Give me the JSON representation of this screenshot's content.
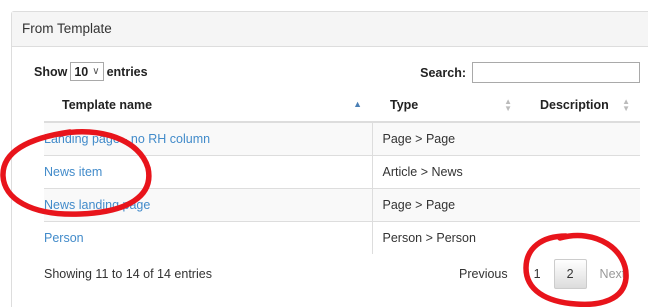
{
  "panel": {
    "title": "From Template"
  },
  "controls": {
    "show_label": "Show",
    "page_length": "10",
    "entries_label": "entries",
    "search_label": "Search:",
    "search_value": ""
  },
  "table": {
    "headers": [
      "Template name",
      "Type",
      "Description"
    ],
    "rows": [
      {
        "name": "Landing page - no RH column",
        "type": "Page > Page",
        "description": ""
      },
      {
        "name": "News item",
        "type": "Article > News",
        "description": ""
      },
      {
        "name": "News landing page",
        "type": "Page > Page",
        "description": ""
      },
      {
        "name": "Person",
        "type": "Person > Person",
        "description": ""
      }
    ]
  },
  "footer": {
    "info": "Showing 11 to 14 of 14 entries",
    "previous": "Previous",
    "pages": [
      "1",
      "2"
    ],
    "current_page": "2",
    "next": "Next"
  },
  "colors": {
    "link": "#428bca",
    "annotation": "#e8141b",
    "sort_active": "#4a7fb5"
  },
  "annotations": [
    {
      "type": "ellipse",
      "target": "News item"
    },
    {
      "type": "ellipse",
      "target": "page 2"
    }
  ]
}
